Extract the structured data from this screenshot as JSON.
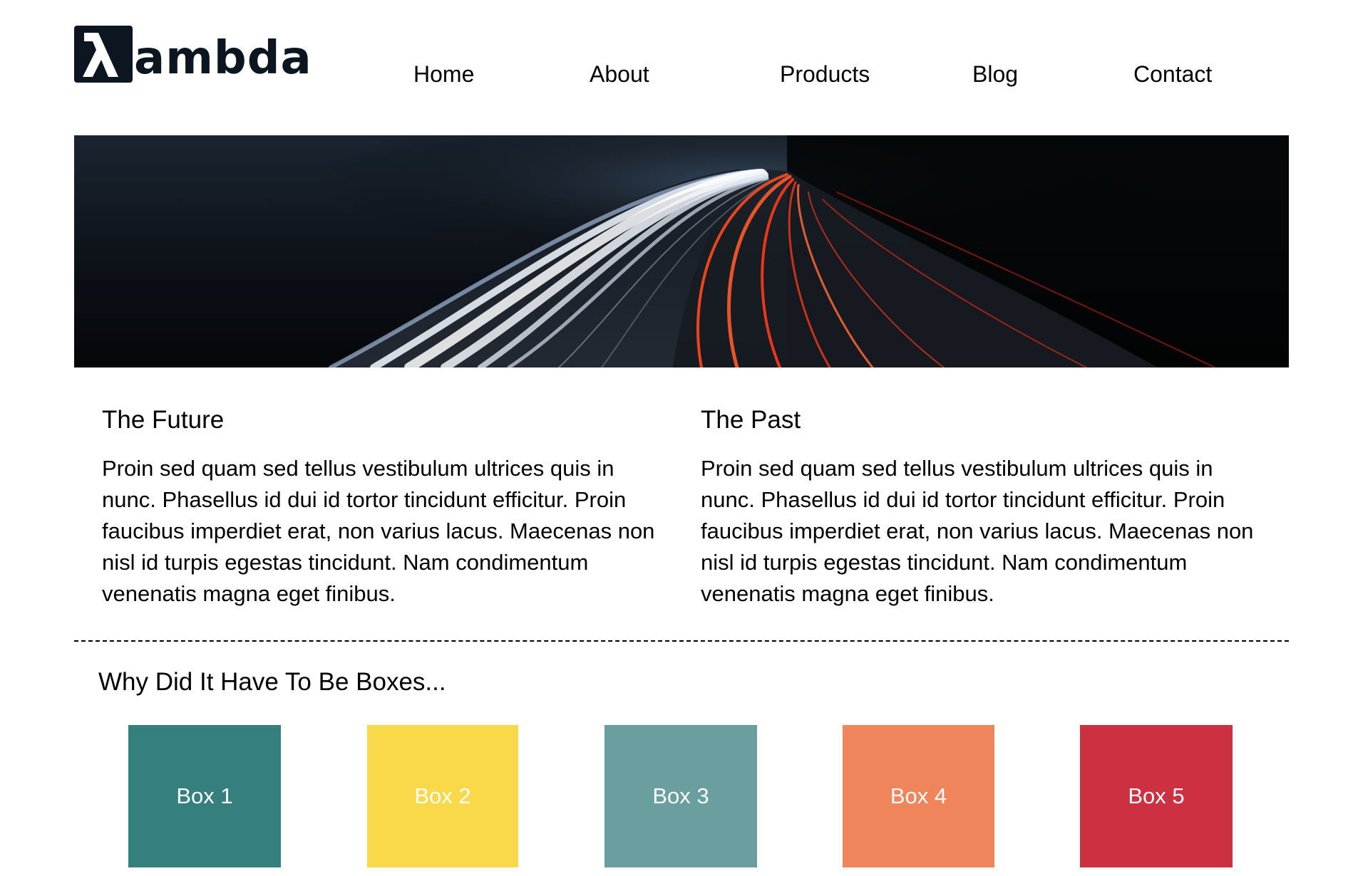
{
  "brand": {
    "logo_mark": "λ",
    "logo_text": "ambda"
  },
  "nav": {
    "items": [
      {
        "label": "Home"
      },
      {
        "label": "About"
      },
      {
        "label": "Products"
      },
      {
        "label": "Blog"
      },
      {
        "label": "Contact"
      }
    ]
  },
  "hero": {
    "image": "night-highway-light-trails"
  },
  "columns": [
    {
      "title": "The Future",
      "text": "Proin sed quam sed tellus vestibulum ultrices quis in nunc. Phasellus id dui id tortor tincidunt efficitur. Proin faucibus imperdiet erat, non varius lacus. Maecenas non nisl id turpis egestas tincidunt. Nam condimentum venenatis magna eget finibus."
    },
    {
      "title": "The Past",
      "text": "Proin sed quam sed tellus vestibulum ultrices quis in nunc. Phasellus id dui id tortor tincidunt efficitur. Proin faucibus imperdiet erat, non varius lacus. Maecenas non nisl id turpis egestas tincidunt. Nam condimentum venenatis magna eget finibus."
    }
  ],
  "boxes_section": {
    "title": "Why Did It Have To Be Boxes...",
    "boxes": [
      {
        "label": "Box 1",
        "color": "#367f7f"
      },
      {
        "label": "Box 2",
        "color": "#f9d84a"
      },
      {
        "label": "Box 3",
        "color": "#6b9e9e"
      },
      {
        "label": "Box 4",
        "color": "#f0845a"
      },
      {
        "label": "Box 5",
        "color": "#cd3041"
      }
    ]
  }
}
